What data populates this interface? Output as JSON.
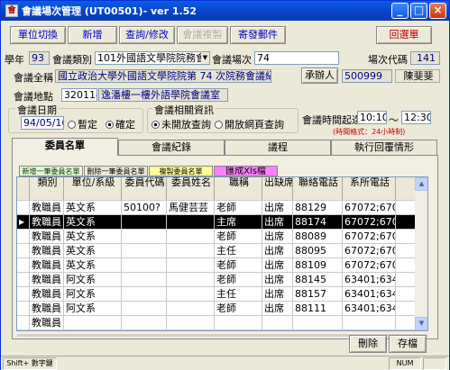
{
  "window": {
    "title": "會議場次管理 (UT00501)- ver 1.52",
    "icon": "app-icon"
  },
  "toolbar": {
    "unit_switch": "單位切換",
    "add": "新增",
    "query_edit": "查詢/修改",
    "meeting_copy": "會議複製",
    "send_mail": "寄發郵件",
    "back_menu": "回選單"
  },
  "form": {
    "year_label": "學年",
    "year_value": "93",
    "category_label": "會議類別",
    "category_value": "101外國語文學院院務會",
    "session_label": "會議場次",
    "session_value": "74",
    "code_label": "場次代碼",
    "code_value": "141",
    "fullname_label": "會議全稱",
    "fullname_value": "國立政治大學外國語文學院院第 74 次院務會議紀錄",
    "organizer_label": "承辦人",
    "organizer_id": "500999",
    "organizer_name": "陳斐斐",
    "location_label": "會議地點",
    "location_code": "320114",
    "location_name": "逸潘樓一樓外語學院會議室",
    "date_group": "會議日期",
    "date_value": "94/05/16",
    "date_tentative": "暫定",
    "date_confirmed": "確定",
    "info_group": "會議相關資訊",
    "info_closed": "未開放查詢",
    "info_open": "開放網頁查詢",
    "time_label": "會議時間起迄",
    "time_start": "10:10",
    "time_sep": "～",
    "time_end": "12:30",
    "time_hint": "(時間格式：24小時制)"
  },
  "tabs": [
    "委員名單",
    "會議紀錄",
    "議程",
    "執行回覆情形"
  ],
  "subtabs": {
    "add_member": "新增一筆委員名單",
    "delete_member": "刪除一筆委員名單",
    "copy_member": "複製委員名單",
    "export_xls": "匯成Xls檔"
  },
  "table": {
    "headers": [
      "類別",
      "單位/系級",
      "委員代碼",
      "委員姓名",
      "職稱",
      "出缺席狀況",
      "聯絡電話",
      "系所電話"
    ],
    "rows": [
      [
        "教職員",
        "英文系",
        "50100?",
        "馬健芸芸",
        "老師",
        "出席",
        "88129",
        "67072;67071"
      ],
      [
        "教職員",
        "英文系",
        "",
        "",
        "主席",
        "出席",
        "88174",
        "67072;67071"
      ],
      [
        "教職員",
        "英文系",
        "",
        "",
        "老師",
        "出席",
        "88089",
        "67072;67071"
      ],
      [
        "教職員",
        "英文系",
        "",
        "",
        "主任",
        "出席",
        "88095",
        "67072;67071"
      ],
      [
        "教職員",
        "英文系",
        "",
        "",
        "老師",
        "出席",
        "88109",
        "67072;67071"
      ],
      [
        "教職員",
        "阿文系",
        "",
        "",
        "老師",
        "出席",
        "88145",
        "63401;63402"
      ],
      [
        "教職員",
        "阿文系",
        "",
        "",
        "主任",
        "出席",
        "88157",
        "63401;63402"
      ],
      [
        "教職員",
        "阿文系",
        "",
        "",
        "老師",
        "出席",
        "88111",
        "63401;63402"
      ],
      [
        "教職員",
        "",
        "",
        "",
        "",
        "",
        "",
        ""
      ]
    ],
    "selected_row": 1
  },
  "actions": {
    "delete": "刪除",
    "save": "存檔"
  },
  "statusbar": {
    "ime": "Shift+ 數字鍵",
    "num": "NUM"
  }
}
